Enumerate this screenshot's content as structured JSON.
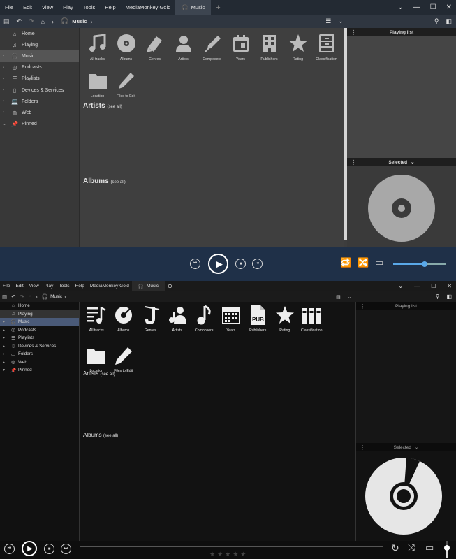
{
  "menu": [
    "File",
    "Edit",
    "View",
    "Play",
    "Tools",
    "Help",
    "MediaMonkey Gold"
  ],
  "tab_label": "Music",
  "add_tab": "+",
  "breadcrumb": "Music",
  "sidebar": {
    "items": [
      {
        "label": "Home",
        "icon": "home-icon"
      },
      {
        "label": "Playing",
        "icon": "music-note-icon"
      },
      {
        "label": "Music",
        "icon": "headphones-icon"
      },
      {
        "label": "Podcasts",
        "icon": "podcast-icon"
      },
      {
        "label": "Playlists",
        "icon": "list-icon"
      },
      {
        "label": "Devices & Services",
        "icon": "phone-icon"
      },
      {
        "label": "Folders",
        "icon": "laptop-icon"
      },
      {
        "label": "Web",
        "icon": "globe-icon"
      },
      {
        "label": "Pinned",
        "icon": "pin-icon"
      }
    ]
  },
  "categories_top": [
    "All tracks",
    "Albums",
    "Genres",
    "Artists",
    "Composers",
    "Years",
    "Publishers",
    "Rating",
    "Classification",
    "Location",
    "Files to Edit"
  ],
  "categories_bottom": [
    "All tracks",
    "Albums",
    "Genres",
    "Artists",
    "Composers",
    "Years",
    "Publishers",
    "Rating",
    "Classification",
    "Location",
    "Files to Edit"
  ],
  "sections": {
    "artists": "Artists",
    "albums": "Albums",
    "see_all": "(see all)"
  },
  "right_panel": {
    "playing_list": "Playing list",
    "selected": "Selected"
  },
  "publisher_badge": "PUB",
  "volume": 0.6,
  "rating_stars": "★★★★★",
  "colors": {
    "top_bg": "#3d3d3d",
    "top_player": "#1f3048",
    "accent_blue": "#4a5a78",
    "volume_thumb": "#5aa8e8"
  }
}
